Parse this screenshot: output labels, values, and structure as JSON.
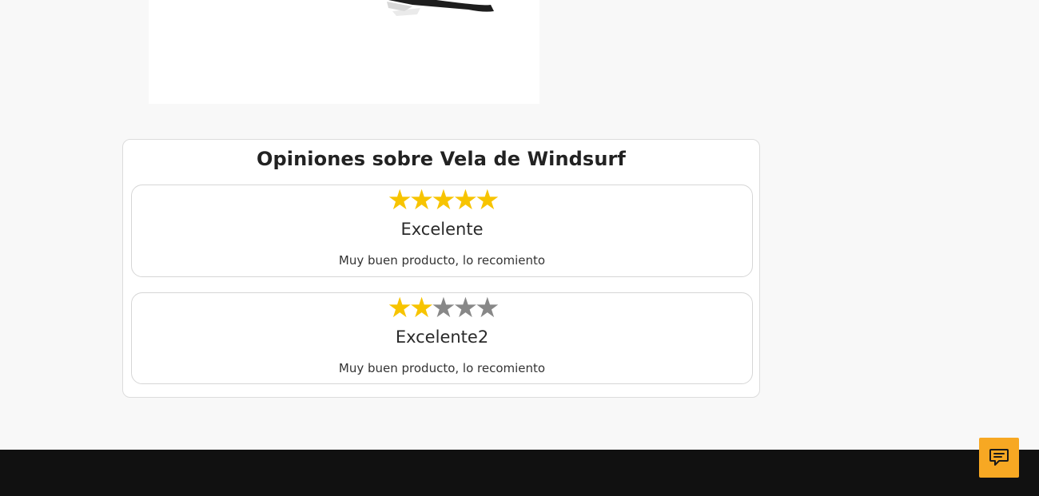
{
  "reviews_section": {
    "title": "Opiniones sobre Vela de Windsurf",
    "reviews": [
      {
        "rating": 5,
        "max_rating": 5,
        "stars": [
          "★",
          "★",
          "★",
          "★",
          "★"
        ],
        "title": "Excelente",
        "text": "Muy buen producto, lo recomiento"
      },
      {
        "rating": 2,
        "max_rating": 5,
        "stars": [
          "★",
          "★",
          "★",
          "★",
          "★"
        ],
        "title": "Excelente2",
        "text": "Muy buen producto, lo recomiento"
      }
    ]
  },
  "colors": {
    "star_filled": "#f7c400",
    "star_empty": "#888888",
    "chat_button": "#f7a823",
    "footer": "#111111",
    "page_background": "#f8f8f8"
  },
  "icons": {
    "chat": "chat-bubble-icon",
    "product_image": "windsurf-sail-image"
  }
}
